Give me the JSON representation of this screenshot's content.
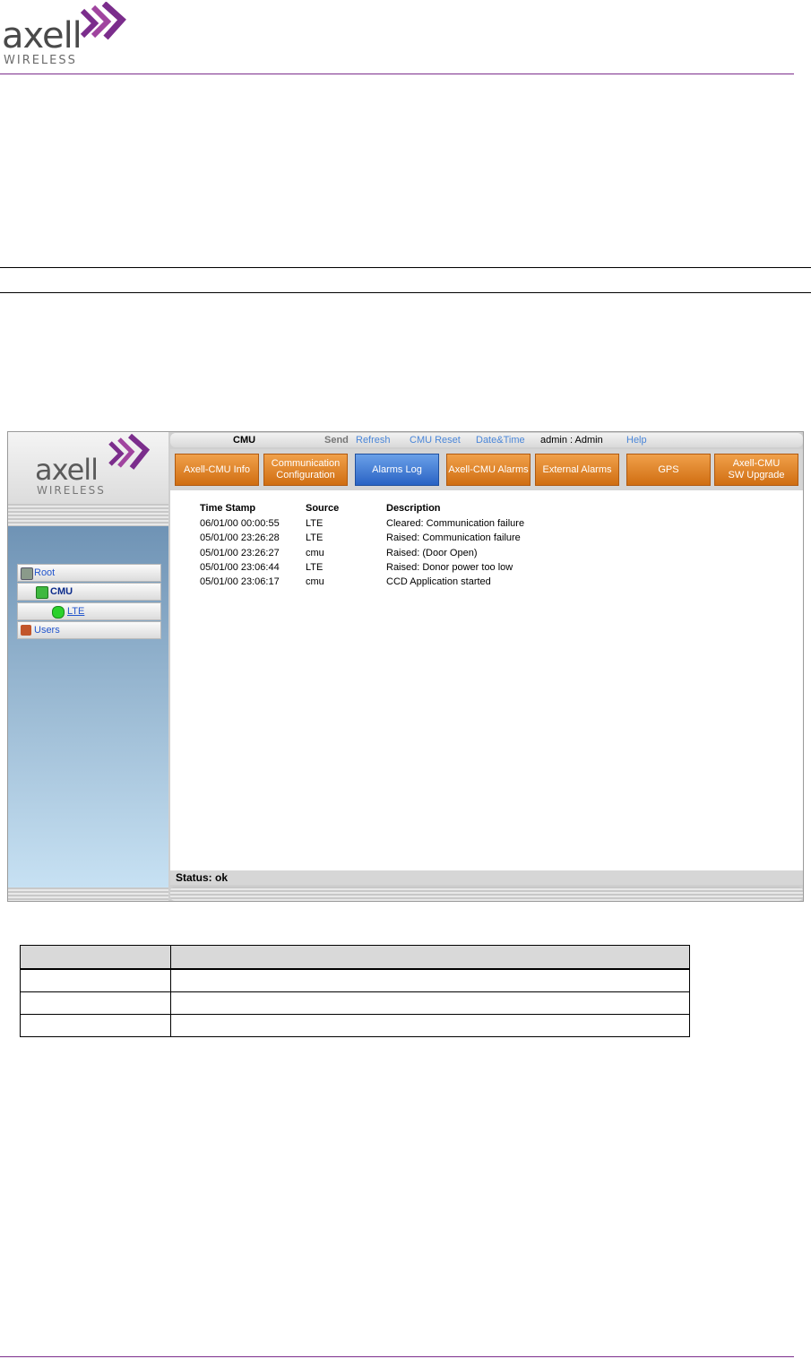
{
  "doc_header": {
    "logo_word": "axell",
    "logo_sub": "WIRELESS"
  },
  "app": {
    "sidebar_logo_word": "axell",
    "sidebar_logo_sub": "WIRELESS",
    "top_menu": {
      "node": "CMU",
      "send": "Send",
      "refresh": "Refresh",
      "reset": "CMU Reset",
      "datetime": "Date&Time",
      "user": "admin : Admin",
      "help": "Help"
    },
    "tabs": [
      {
        "label": "Axell-CMU Info"
      },
      {
        "label": "Communication Configuration"
      },
      {
        "label": "Alarms Log"
      },
      {
        "label": "Axell-CMU Alarms"
      },
      {
        "label": "External Alarms"
      },
      {
        "label": "GPS"
      },
      {
        "label": "Axell-CMU SW Upgrade"
      }
    ],
    "active_tab": "Alarms Log",
    "tree": [
      {
        "label": "Root"
      },
      {
        "label": "CMU"
      },
      {
        "label": "LTE"
      },
      {
        "label": "Users"
      }
    ],
    "log": {
      "columns": [
        "Time Stamp",
        "Source",
        "Description"
      ],
      "rows": [
        [
          "06/01/00 00:00:55",
          "LTE",
          "Cleared: Communication failure"
        ],
        [
          "05/01/00 23:26:28",
          "LTE",
          "Raised: Communication failure"
        ],
        [
          "05/01/00 23:26:27",
          "cmu",
          "Raised: (Door Open)"
        ],
        [
          "05/01/00 23:06:44",
          "LTE",
          "Raised: Donor power too low"
        ],
        [
          "05/01/00 23:06:17",
          "cmu",
          "CCD Application started"
        ]
      ]
    },
    "status": "Status: ok"
  },
  "colors": {
    "brand_purple": "#7b2d8c",
    "tab_orange": "#e07f22",
    "tab_active_blue": "#3a73d4",
    "link_blue": "#2255cc"
  }
}
